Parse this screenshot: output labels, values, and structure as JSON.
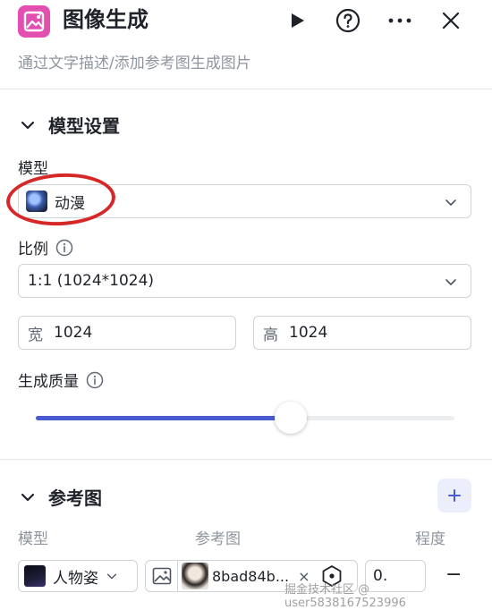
{
  "header": {
    "title": "图像生成",
    "subtitle": "通过文字描述/添加参考图生成图片"
  },
  "model_settings": {
    "section_title": "模型设置",
    "model_label": "模型",
    "model_value": "动漫",
    "ratio_label": "比例",
    "ratio_value": "1:1 (1024*1024)",
    "width_prefix": "宽",
    "width_value": "1024",
    "height_prefix": "高",
    "height_value": "1024",
    "quality_label": "生成质量",
    "quality_level": 0.61
  },
  "reference": {
    "section_title": "参考图",
    "columns": [
      "模型",
      "参考图",
      "程度"
    ],
    "row": {
      "model_value": "人物姿",
      "image_name": "8bad84b...",
      "remove_label": "×",
      "degree_value": "0.",
      "minus_label": "−"
    }
  },
  "watermark": "掘金技术社区 @ user5838167523996",
  "colors": {
    "brand_icon": "#e34fb1",
    "slider_fill": "#4a5bd0",
    "annotation": "#d62828"
  }
}
